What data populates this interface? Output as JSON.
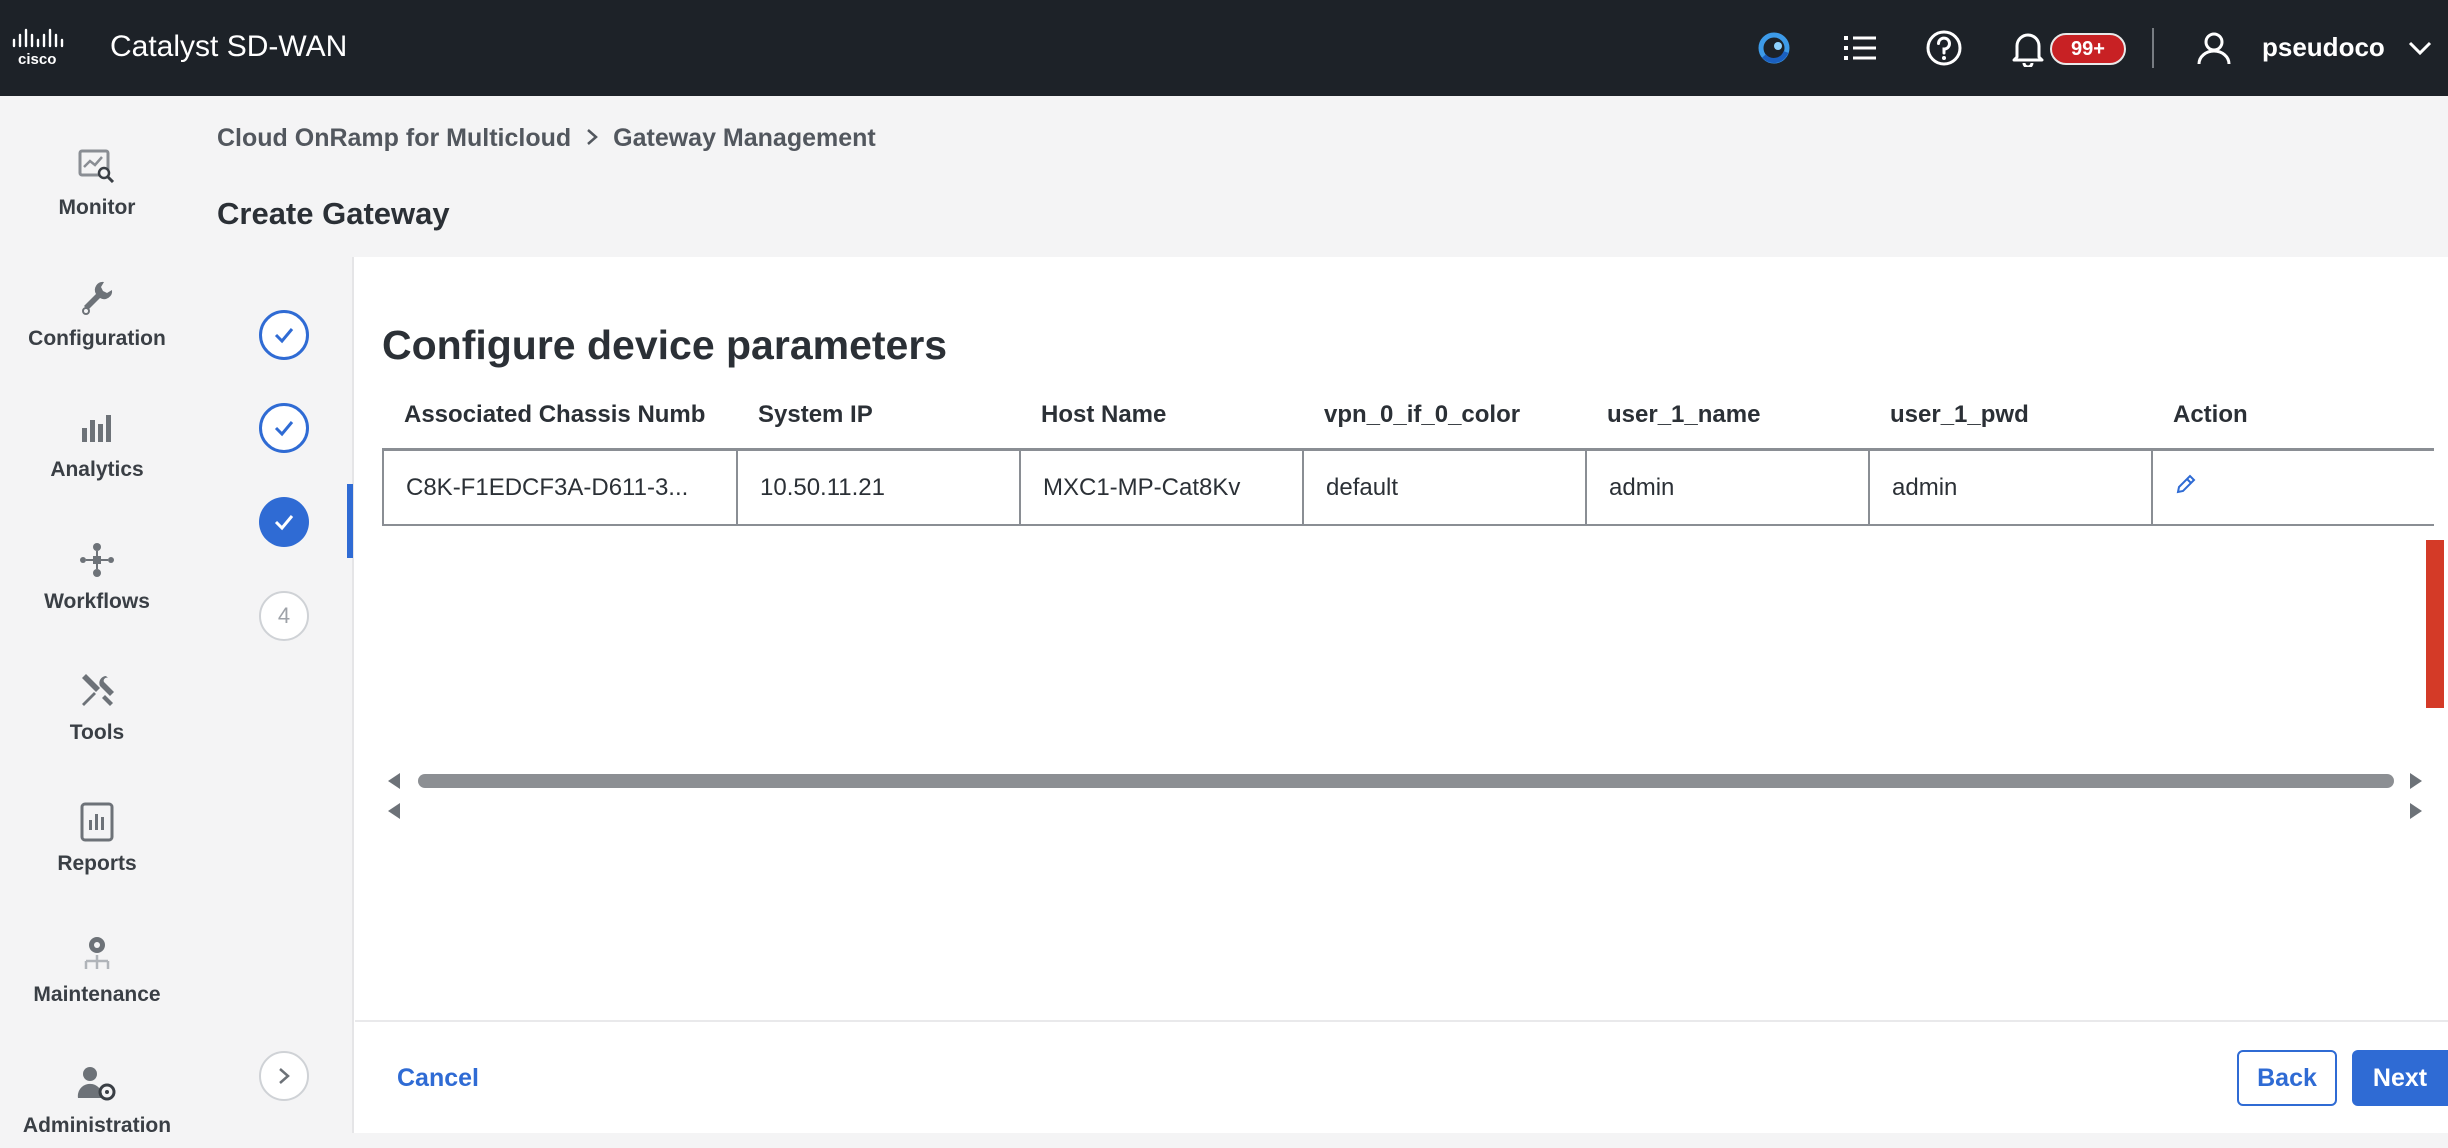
{
  "header": {
    "logo_text": "cisco",
    "app_title": "Catalyst SD-WAN",
    "notification_count": "99+",
    "username": "pseudoco",
    "icons": [
      "assistant-icon",
      "task-list-icon",
      "help-icon",
      "bell-icon",
      "user-icon",
      "chevron-down-icon"
    ]
  },
  "sidebar": {
    "items": [
      {
        "label": "Monitor",
        "icon": "monitor-icon"
      },
      {
        "label": "Configuration",
        "icon": "wrench-icon"
      },
      {
        "label": "Analytics",
        "icon": "analytics-icon"
      },
      {
        "label": "Workflows",
        "icon": "workflow-icon"
      },
      {
        "label": "Tools",
        "icon": "tools-icon"
      },
      {
        "label": "Reports",
        "icon": "report-icon"
      },
      {
        "label": "Maintenance",
        "icon": "maintenance-icon"
      },
      {
        "label": "Administration",
        "icon": "admin-icon"
      }
    ]
  },
  "breadcrumb": {
    "items": [
      "Cloud OnRamp for Multicloud",
      "Gateway Management"
    ],
    "separator": ">"
  },
  "page": {
    "title": "Create Gateway",
    "section_title": "Configure device parameters"
  },
  "stepper": {
    "steps": [
      {
        "state": "done"
      },
      {
        "state": "done"
      },
      {
        "state": "active"
      },
      {
        "state": "pending",
        "label": "4"
      }
    ]
  },
  "table": {
    "columns": [
      "Associated Chassis Numb",
      "System IP",
      "Host Name",
      "vpn_0_if_0_color",
      "user_1_name",
      "user_1_pwd",
      "Action"
    ],
    "rows": [
      {
        "chassis": "C8K-F1EDCF3A-D611-3...",
        "system_ip": "10.50.11.21",
        "host_name": "MXC1-MP-Cat8Kv",
        "vpn_color": "default",
        "user_name": "admin",
        "user_pwd": "admin",
        "action_icon": "edit-icon"
      }
    ]
  },
  "footer": {
    "cancel_label": "Cancel",
    "back_label": "Back",
    "next_label": "Next"
  },
  "colors": {
    "topbar": "#1d2228",
    "accent": "#2f6bd4",
    "badge": "#c82124"
  }
}
